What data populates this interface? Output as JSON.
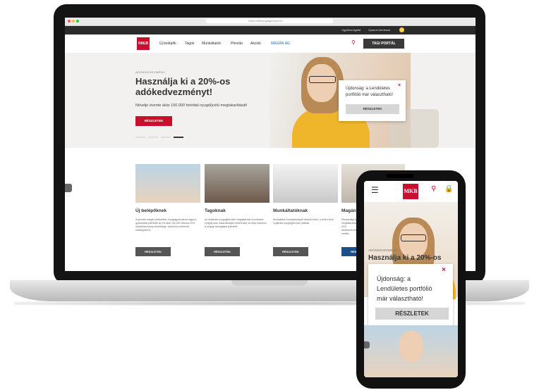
{
  "browser": {
    "url": "www.mkbnyugdijpenztar.hu"
  },
  "topbar": {
    "links": [
      "Ügyfélszolgálat",
      "Gyakori kérdések"
    ]
  },
  "brand": {
    "logo_text": "MKB",
    "accent": "#c8102e"
  },
  "nav": {
    "items": [
      "Új belépők",
      "Tagok",
      "Munkáltatók",
      "Pénztár",
      "Akciók",
      "MAGÁN ÁG"
    ],
    "portal_button": "TAGI PORTÁL"
  },
  "hero": {
    "kicker": "ADÓKEDVEZMÉNY",
    "title": "Használja ki a 20%-os adókedvezményt!",
    "subtitle": "Növelje évente akár 150.000 forinttal nyugdíjcélú megtakarítását!",
    "button": "RÉSZLETEK"
  },
  "popup": {
    "text": "Újdonság: a Lendületes portfólió már választható!",
    "close": "×",
    "button": "RÉSZLETEK"
  },
  "cards": [
    {
      "title": "Új belépőknek",
      "text": "A pénztár magán befektetési. Nyugdíjpénztárral vagyon-gyarapítási jelentheti az évi akár 150.000 forintos 20% adókedvezmény lehetősége, valamint a bedevisó költségüket is.",
      "button": "RÉSZLETEK"
    },
    {
      "title": "Tagoknak",
      "text": "Az önkéntes nyugdíjpénztári megtakarítás a szolidáris nyugdíj után használhatják mellett akár az aktív években is anyagi támogatást jelenthet.",
      "button": "RÉSZLETEK"
    },
    {
      "title": "Munkáltatóknak",
      "text": "Munkáltatói hozzájárulással készült ezzel, a béren kívül nyújtható nyugdíjpénztári juttatás.",
      "button": "RÉSZLETEK"
    },
    {
      "title": "Magán",
      "text": "Kihasználja akár megtakarítását 20% adókedvezmény mellett.",
      "button": "RÉSZLETEK"
    }
  ],
  "phone": {
    "logo_text": "MKB",
    "hero_kicker": "ADÓKEDVEZMÉNY",
    "hero_title": "Használja ki a 20%-os",
    "popup_text": "Újdonság: a Lendületes portfólió már választható!",
    "popup_close": "×",
    "popup_button": "RÉSZLETEK"
  }
}
